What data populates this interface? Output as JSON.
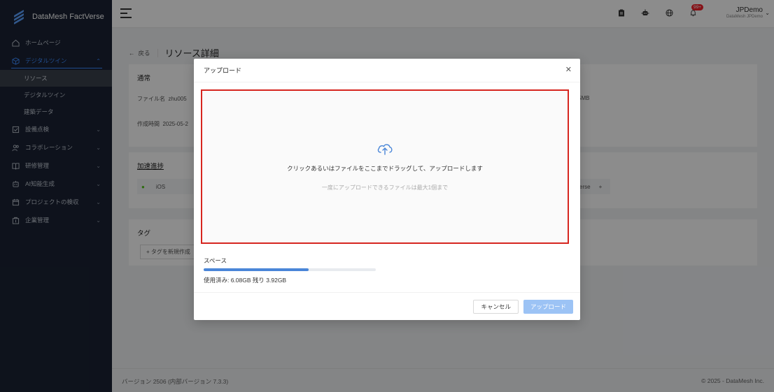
{
  "app": {
    "brand": "DataMesh FactVerse"
  },
  "sidebar": {
    "items": [
      {
        "label": "ホームページ",
        "icon": "home-icon"
      },
      {
        "label": "デジタルツイン",
        "icon": "cube-icon",
        "active": true
      },
      {
        "label": "設備点検",
        "icon": "checklist-icon"
      },
      {
        "label": "コラボレーション",
        "icon": "users-icon"
      },
      {
        "label": "研修管理",
        "icon": "book-icon"
      },
      {
        "label": "AI知能生成",
        "icon": "ai-icon"
      },
      {
        "label": "プロジェクトの検収",
        "icon": "calendar-icon"
      },
      {
        "label": "企業管理",
        "icon": "building-icon"
      }
    ],
    "sub_items": [
      {
        "label": "リソース",
        "selected": true
      },
      {
        "label": "デジタルツイン"
      },
      {
        "label": "建築データ"
      }
    ]
  },
  "header": {
    "badge": "99+",
    "user_name": "JPDemo",
    "user_org": "DataMesh JPDemo"
  },
  "page": {
    "back_label": "戻る",
    "title": "リソース詳細",
    "card1": {
      "title": "通常",
      "file_name_label": "ファイル名",
      "file_name_value": "zhu005",
      "created_label": "作成時間",
      "created_value": "2025-05-2",
      "size_tail": "5MB"
    },
    "card2": {
      "title": "加速進捗",
      "platform": "iOS",
      "platform_tail": "erse"
    },
    "card3": {
      "title": "タグ",
      "add_tag": "+ タグを新規作成"
    }
  },
  "footer": {
    "version": "バージョン 2506 (内部バージョン 7.3.3)",
    "copyright": "© 2025 - DataMesh Inc."
  },
  "modal": {
    "title": "アップロード",
    "drop_main": "クリックあるいはファイルをここまでドラッグして、アップロードします",
    "drop_hint": "一度にアップロードできるファイルは最大1個まで",
    "space_label": "スペース",
    "usage_text": "使用済み: 6.08GB  残り 3.92GB",
    "usage_fraction": 0.608,
    "cancel_label": "キャンセル",
    "upload_label": "アップロード"
  },
  "colors": {
    "accent": "#3d8bff",
    "highlight_border": "#d6251f",
    "progress": "#4a86d8"
  }
}
